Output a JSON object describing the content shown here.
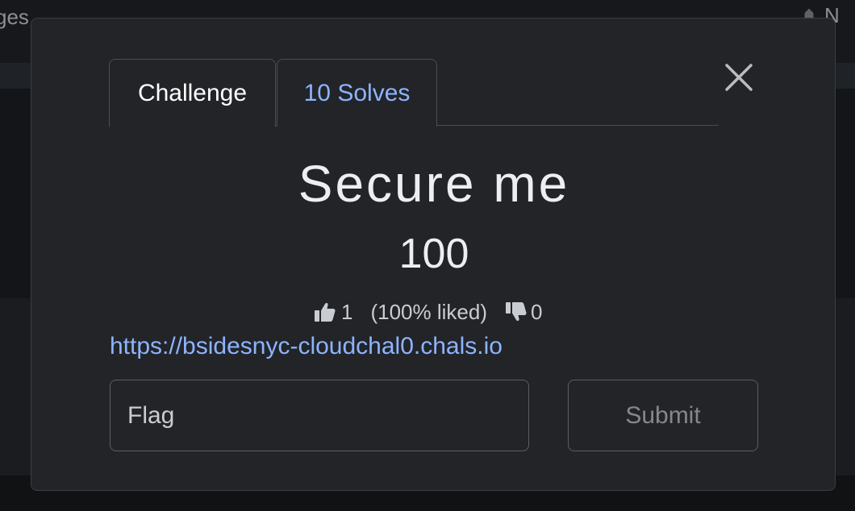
{
  "background": {
    "nav_left_fragment": "ges",
    "nav_right_fragment": "N"
  },
  "modal": {
    "tabs": [
      {
        "label": "Challenge",
        "active": true
      },
      {
        "label": "10 Solves",
        "active": false
      }
    ],
    "challenge": {
      "name": "Secure me",
      "points": "100",
      "likes": "1",
      "liked_percent": "(100% liked)",
      "dislikes": "0",
      "link": "https://bsidesnyc-cloudchal0.chals.io"
    },
    "flag_input": {
      "placeholder": "Flag",
      "value": ""
    },
    "submit_label": "Submit"
  },
  "colors": {
    "modal_bg": "#222428",
    "accent_link": "#8db4ff",
    "text": "#eceef1"
  },
  "icons": {
    "close": "close-icon",
    "like": "thumbs-up-icon",
    "dislike": "thumbs-down-icon",
    "bell": "bell-icon"
  }
}
